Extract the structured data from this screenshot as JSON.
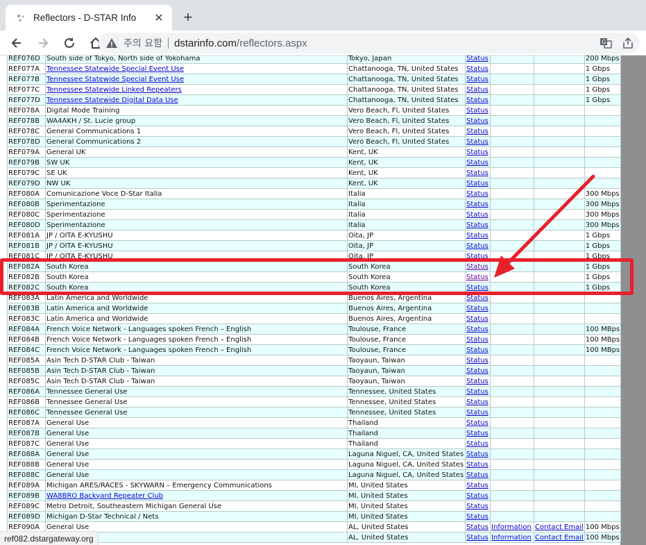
{
  "browser": {
    "tab_title": "Reflectors - D-STAR Info",
    "security_label": "주의 요함",
    "url_host": "dstarinfo.com",
    "url_path": "/reflectors.aspx",
    "status_url": "ref082.dstargateway.org"
  },
  "table": {
    "rows": [
      {
        "ref": "REF076D",
        "desc": "South side of Tokyo, North side of Yokohama",
        "loc": "Tokyo, Japan",
        "status": "Status",
        "info": "",
        "contact": "",
        "bw": "200 Mbps",
        "desc_link": false,
        "visited": false
      },
      {
        "ref": "REF077A",
        "desc": "Tennessee Statewide Special Event Use",
        "loc": "Chattanooga, TN, United States",
        "status": "Status",
        "info": "",
        "contact": "",
        "bw": "1 Gbps",
        "desc_link": true,
        "visited": false
      },
      {
        "ref": "REF077B",
        "desc": "Tennessee Statewide Special Event Use",
        "loc": "Chattanooga, TN, United States",
        "status": "Status",
        "info": "",
        "contact": "",
        "bw": "1 Gbps",
        "desc_link": true,
        "visited": false
      },
      {
        "ref": "REF077C",
        "desc": "Tennessee Statewide Linked Repeaters",
        "loc": "Chattanooga, TN, United States",
        "status": "Status",
        "info": "",
        "contact": "",
        "bw": "1 Gbps",
        "desc_link": true,
        "visited": false
      },
      {
        "ref": "REF077D",
        "desc": "Tennessee Statewide Digital Data Use",
        "loc": "Chattanooga, TN, United States",
        "status": "Status",
        "info": "",
        "contact": "",
        "bw": "1 Gbps",
        "desc_link": true,
        "visited": false
      },
      {
        "ref": "REF078A",
        "desc": "Digital Mode Training",
        "loc": "Vero Beach, Fl, United States",
        "status": "Status",
        "info": "",
        "contact": "",
        "bw": "",
        "desc_link": false,
        "visited": false
      },
      {
        "ref": "REF078B",
        "desc": "WA4AKH / St. Lucie group",
        "loc": "Vero Beach, Fl, United States",
        "status": "Status",
        "info": "",
        "contact": "",
        "bw": "",
        "desc_link": false,
        "visited": false
      },
      {
        "ref": "REF078C",
        "desc": "General Communications 1",
        "loc": "Vero Beach, Fl, United States",
        "status": "Status",
        "info": "",
        "contact": "",
        "bw": "",
        "desc_link": false,
        "visited": false
      },
      {
        "ref": "REF078D",
        "desc": "General Communications 2",
        "loc": "Vero Beach, Fl, United States",
        "status": "Status",
        "info": "",
        "contact": "",
        "bw": "",
        "desc_link": false,
        "visited": false
      },
      {
        "ref": "REF079A",
        "desc": "General UK",
        "loc": "Kent, UK",
        "status": "Status",
        "info": "",
        "contact": "",
        "bw": "",
        "desc_link": false,
        "visited": false
      },
      {
        "ref": "REF079B",
        "desc": "SW UK",
        "loc": "Kent, UK",
        "status": "Status",
        "info": "",
        "contact": "",
        "bw": "",
        "desc_link": false,
        "visited": false
      },
      {
        "ref": "REF079C",
        "desc": "SE UK",
        "loc": "Kent, UK",
        "status": "Status",
        "info": "",
        "contact": "",
        "bw": "",
        "desc_link": false,
        "visited": false
      },
      {
        "ref": "REF079D",
        "desc": "NW UK",
        "loc": "Kent, UK",
        "status": "Status",
        "info": "",
        "contact": "",
        "bw": "",
        "desc_link": false,
        "visited": false
      },
      {
        "ref": "REF080A",
        "desc": "Comunicazione Voce D-Star Italia",
        "loc": "Italia",
        "status": "Status",
        "info": "",
        "contact": "",
        "bw": "300 Mbps",
        "desc_link": false,
        "visited": false
      },
      {
        "ref": "REF080B",
        "desc": "Sperimentazione",
        "loc": "Italia",
        "status": "Status",
        "info": "",
        "contact": "",
        "bw": "300 Mbps",
        "desc_link": false,
        "visited": false
      },
      {
        "ref": "REF080C",
        "desc": "Sperimentazione",
        "loc": "Italia",
        "status": "Status",
        "info": "",
        "contact": "",
        "bw": "300 Mbps",
        "desc_link": false,
        "visited": false
      },
      {
        "ref": "REF080D",
        "desc": "Sperimentazione",
        "loc": "Italia",
        "status": "Status",
        "info": "",
        "contact": "",
        "bw": "300 Mbps",
        "desc_link": false,
        "visited": false
      },
      {
        "ref": "REF081A",
        "desc": "JP / OITA E-KYUSHU",
        "loc": "Oita, JP",
        "status": "Status",
        "info": "",
        "contact": "",
        "bw": "1 Gbps",
        "desc_link": false,
        "visited": false
      },
      {
        "ref": "REF081B",
        "desc": "JP / OITA E-KYUSHU",
        "loc": "Oita, JP",
        "status": "Status",
        "info": "",
        "contact": "",
        "bw": "1 Gbps",
        "desc_link": false,
        "visited": false
      },
      {
        "ref": "REF081C",
        "desc": "JP / OITA E-KYUSHU",
        "loc": "Oita, JP",
        "status": "Status",
        "info": "",
        "contact": "",
        "bw": "1 Gbps",
        "desc_link": false,
        "visited": false
      },
      {
        "ref": "REF082A",
        "desc": "South Korea",
        "loc": "South Korea",
        "status": "Status",
        "info": "",
        "contact": "",
        "bw": "1 Gbps",
        "desc_link": false,
        "visited": true
      },
      {
        "ref": "REF082B",
        "desc": "South Korea",
        "loc": "South Korea",
        "status": "Status",
        "info": "",
        "contact": "",
        "bw": "1 Gbps",
        "desc_link": false,
        "visited": true
      },
      {
        "ref": "REF082C",
        "desc": "South Korea",
        "loc": "South Korea",
        "status": "Status",
        "info": "",
        "contact": "",
        "bw": "1 Gbps",
        "desc_link": false,
        "visited": false
      },
      {
        "ref": "REF083A",
        "desc": "Latin America and Worldwide",
        "loc": "Buenos Aires, Argentina",
        "status": "Status",
        "info": "",
        "contact": "",
        "bw": "",
        "desc_link": false,
        "visited": false
      },
      {
        "ref": "REF083B",
        "desc": "Latin America and Worldwide",
        "loc": "Buenos Aires, Argentina",
        "status": "Status",
        "info": "",
        "contact": "",
        "bw": "",
        "desc_link": false,
        "visited": false
      },
      {
        "ref": "REF083C",
        "desc": "Latin America and Worldwide",
        "loc": "Buenos Aires, Argentina",
        "status": "Status",
        "info": "",
        "contact": "",
        "bw": "",
        "desc_link": false,
        "visited": false
      },
      {
        "ref": "REF084A",
        "desc": "French Voice Network - Languages spoken French – English",
        "loc": "Toulouse, France",
        "status": "Status",
        "info": "",
        "contact": "",
        "bw": "100 MBps",
        "desc_link": false,
        "visited": false
      },
      {
        "ref": "REF084B",
        "desc": "French Voice Network - Languages spoken French – English",
        "loc": "Toulouse, France",
        "status": "Status",
        "info": "",
        "contact": "",
        "bw": "100 MBps",
        "desc_link": false,
        "visited": false
      },
      {
        "ref": "REF084C",
        "desc": "French Voice Network - Languages spoken French – English",
        "loc": "Toulouse, France",
        "status": "Status",
        "info": "",
        "contact": "",
        "bw": "100 MBps",
        "desc_link": false,
        "visited": false
      },
      {
        "ref": "REF085A",
        "desc": "Asin Tech D-STAR Club - Taiwan",
        "loc": "Taoyaun, Taiwan",
        "status": "Status",
        "info": "",
        "contact": "",
        "bw": "",
        "desc_link": false,
        "visited": false
      },
      {
        "ref": "REF085B",
        "desc": "Asin Tech D-STAR Club - Taiwan",
        "loc": "Taoyaun, Taiwan",
        "status": "Status",
        "info": "",
        "contact": "",
        "bw": "",
        "desc_link": false,
        "visited": false
      },
      {
        "ref": "REF085C",
        "desc": "Asin Tech D-STAR Club - Taiwan",
        "loc": "Taoyaun, Taiwan",
        "status": "Status",
        "info": "",
        "contact": "",
        "bw": "",
        "desc_link": false,
        "visited": false
      },
      {
        "ref": "REF086A",
        "desc": "Tennessee General Use",
        "loc": "Tennessee, United States",
        "status": "Status",
        "info": "",
        "contact": "",
        "bw": "",
        "desc_link": false,
        "visited": false
      },
      {
        "ref": "REF086B",
        "desc": "Tennessee General Use",
        "loc": "Tennessee, United States",
        "status": "Status",
        "info": "",
        "contact": "",
        "bw": "",
        "desc_link": false,
        "visited": false
      },
      {
        "ref": "REF086C",
        "desc": "Tennessee General Use",
        "loc": "Tennessee, United States",
        "status": "Status",
        "info": "",
        "contact": "",
        "bw": "",
        "desc_link": false,
        "visited": false
      },
      {
        "ref": "REF087A",
        "desc": "General Use",
        "loc": "Thailand",
        "status": "Status",
        "info": "",
        "contact": "",
        "bw": "",
        "desc_link": false,
        "visited": false
      },
      {
        "ref": "REF087B",
        "desc": "General Use",
        "loc": "Thailand",
        "status": "Status",
        "info": "",
        "contact": "",
        "bw": "",
        "desc_link": false,
        "visited": false
      },
      {
        "ref": "REF087C",
        "desc": "General Use",
        "loc": "Thailand",
        "status": "Status",
        "info": "",
        "contact": "",
        "bw": "",
        "desc_link": false,
        "visited": false
      },
      {
        "ref": "REF088A",
        "desc": "General Use",
        "loc": "Laguna Niguel, CA, United States",
        "status": "Status",
        "info": "",
        "contact": "",
        "bw": "",
        "desc_link": false,
        "visited": false
      },
      {
        "ref": "REF088B",
        "desc": "General Use",
        "loc": "Laguna Niguel, CA, United States",
        "status": "Status",
        "info": "",
        "contact": "",
        "bw": "",
        "desc_link": false,
        "visited": false
      },
      {
        "ref": "REF088C",
        "desc": "General Use",
        "loc": "Laguna Niguel, CA, United States",
        "status": "Status",
        "info": "",
        "contact": "",
        "bw": "",
        "desc_link": false,
        "visited": false
      },
      {
        "ref": "REF089A",
        "desc": "Michigan ARES/RACES - SKYWARN – Emergency Communications",
        "loc": "MI, United States",
        "status": "Status",
        "info": "",
        "contact": "",
        "bw": "",
        "desc_link": false,
        "visited": false
      },
      {
        "ref": "REF089B",
        "desc": "WA8BRO Backyard Repeater Club",
        "loc": "MI, United States",
        "status": "Status",
        "info": "",
        "contact": "",
        "bw": "",
        "desc_link": true,
        "visited": false
      },
      {
        "ref": "REF089C",
        "desc": "Metro Detroit, Southeastern Michigan General Use",
        "loc": "MI, United States",
        "status": "Status",
        "info": "",
        "contact": "",
        "bw": "",
        "desc_link": false,
        "visited": false
      },
      {
        "ref": "REF089D",
        "desc": "Michigan D-Star Technical / Nets",
        "loc": "MI, United States",
        "status": "Status",
        "info": "",
        "contact": "",
        "bw": "",
        "desc_link": false,
        "visited": false
      },
      {
        "ref": "REF090A",
        "desc": "General Use",
        "loc": "AL, United States",
        "status": "Status",
        "info": "Information",
        "contact": "Contact Email",
        "bw": "100 Mbps",
        "desc_link": false,
        "visited": false
      },
      {
        "ref": "REF090B",
        "desc": "General Use",
        "loc": "AL, United States",
        "status": "Status",
        "info": "Information",
        "contact": "Contact Email",
        "bw": "100 Mbps",
        "desc_link": false,
        "visited": false
      }
    ]
  },
  "annotation": {
    "highlight_color": "#e8202c"
  }
}
